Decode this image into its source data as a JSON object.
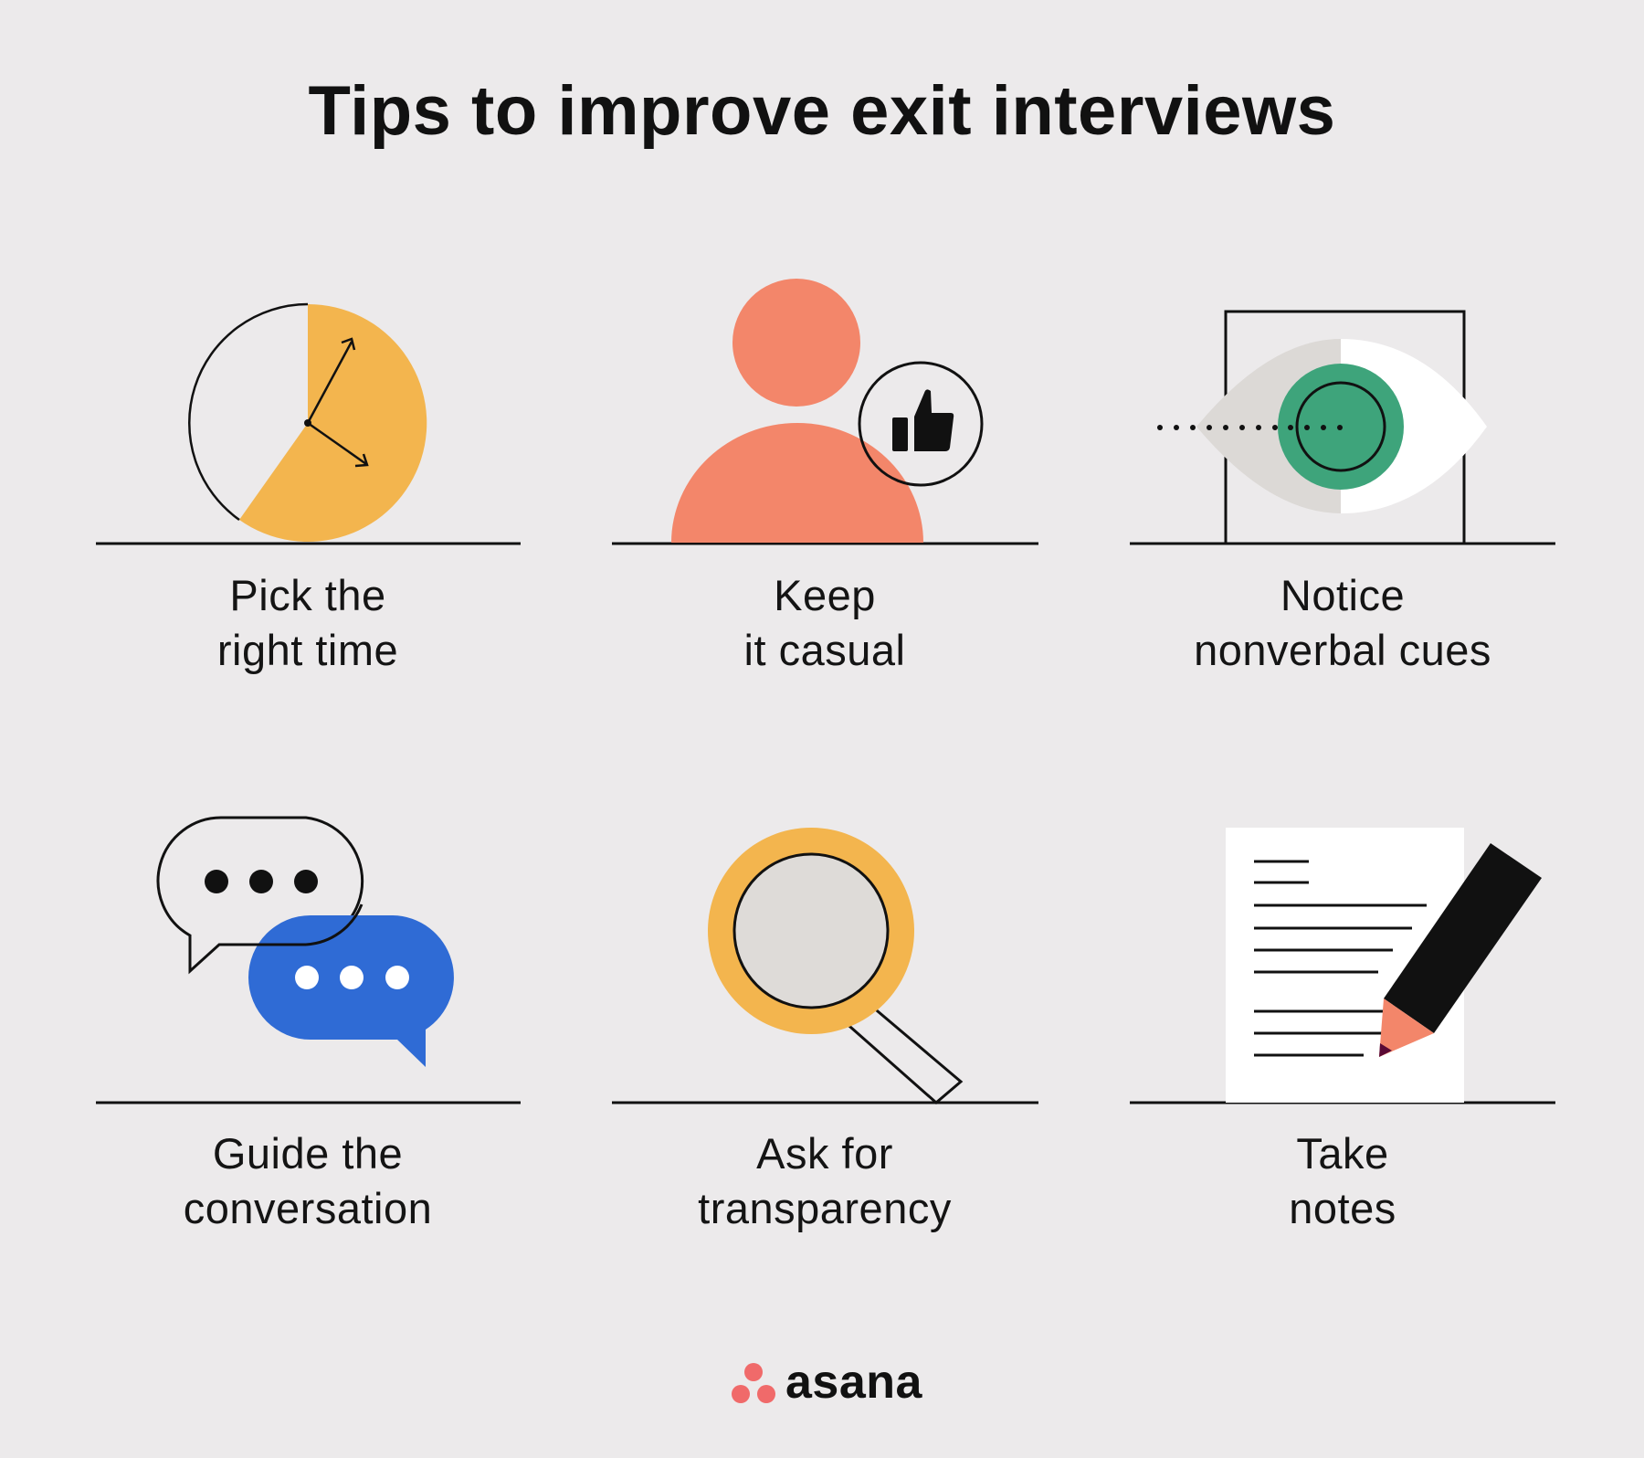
{
  "title": "Tips to improve exit interviews",
  "tips": [
    {
      "line1": "Pick the",
      "line2": "right time",
      "icon": "clock-icon"
    },
    {
      "line1": "Keep",
      "line2": "it casual",
      "icon": "person-thumbs-up-icon"
    },
    {
      "line1": "Notice",
      "line2": "nonverbal cues",
      "icon": "eye-icon"
    },
    {
      "line1": "Guide the",
      "line2": "conversation",
      "icon": "chat-bubbles-icon"
    },
    {
      "line1": "Ask for",
      "line2": "transparency",
      "icon": "magnifying-glass-icon"
    },
    {
      "line1": "Take",
      "line2": "notes",
      "icon": "notes-pencil-icon"
    }
  ],
  "brand": {
    "name": "asana",
    "logo": "asana-dots-logo"
  },
  "colors": {
    "background": "#eceaeb",
    "yellow": "#f3b54e",
    "coral": "#f3866a",
    "green": "#3ea47b",
    "blue": "#2f6bd5",
    "ink": "#111111",
    "logo_coral": "#f06a6a"
  }
}
